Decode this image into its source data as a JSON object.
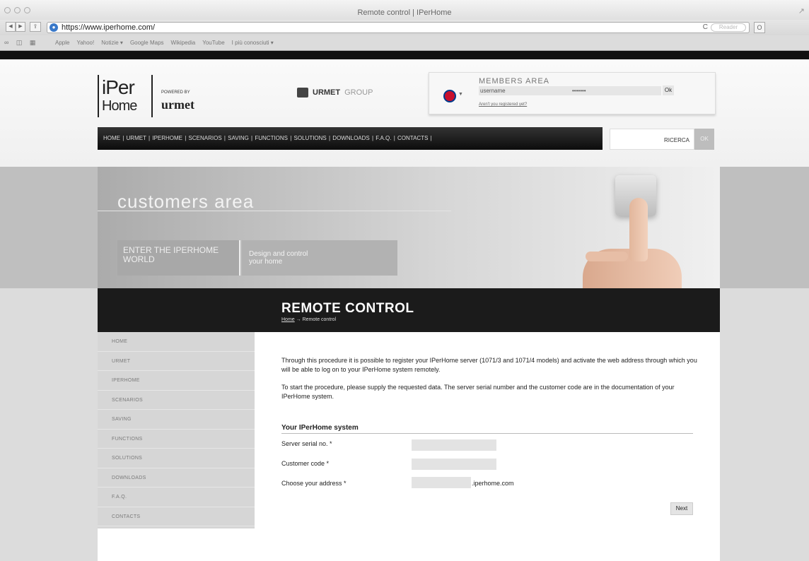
{
  "browser": {
    "window_title": "Remote control | IPerHome",
    "nav_back": "◀",
    "nav_forward": "▶",
    "share": "⇪",
    "url": "https://www.iperhome.com/",
    "reload": "C",
    "reader": "Reader",
    "right_button": "O",
    "bookmark_icons": "∞ ◫ ▦",
    "bookmarks": [
      "Apple",
      "Yahoo!",
      "Notizie ▾",
      "Google Maps",
      "Wikipedia",
      "YouTube",
      "I più conosciuti ▾"
    ]
  },
  "header": {
    "logo_line1": "iPer",
    "logo_line2": "Home",
    "powered_by": "POWERED BY",
    "urmet": "urmet",
    "group_logo_bold": "URMET",
    "group_logo_light": "GROUP",
    "members": {
      "title": "MEMBERS AREA",
      "username_value": "username",
      "password_value": "•••••••",
      "ok_label": "Ok",
      "register_link": "Aren't you registered yet?"
    },
    "nav_items": "HOME  |  URMET  |  IPERHOME  |  SCENARIOS  |  SAVING  |  FUNCTIONS  |  SOLUTIONS  |  DOWNLOADS  |  F.A.Q.  |  CONTACTS  |",
    "search_label": "RICERCA",
    "search_ok": "OK"
  },
  "hero": {
    "title": "customers area",
    "enter_world_line1": "ENTER THE IPERHOME",
    "enter_world_line2": "WORLD",
    "design_line1": "Design and control",
    "design_line2": "your home"
  },
  "page": {
    "title": "REMOTE CONTROL",
    "breadcrumb_home": "Home",
    "breadcrumb_sep": " → ",
    "breadcrumb_current": "Remote control",
    "side_menu": [
      "HOME",
      "URMET",
      "IPERHOME",
      "SCENARIOS",
      "SAVING",
      "FUNCTIONS",
      "SOLUTIONS",
      "DOWNLOADS",
      "F.A.Q.",
      "CONTACTS"
    ],
    "intro_p1": "Through this procedure it is possible to register your IPerHome server (1071/3 and 1071/4 models) and activate the web address through which you will be able to log on to your IPerHome system remotely.",
    "intro_p2": "To start the procedure, please supply the requested data. The server serial number and the customer code are in the documentation of your IPerHome system.",
    "system_title": "Your IPerHome system",
    "fields": {
      "serial_label": "Server serial no. *",
      "customer_label": "Customer code *",
      "address_label": "Choose your address *",
      "address_suffix": ".iperhome.com"
    },
    "next_label": "Next"
  },
  "colors": {
    "nav_bar": "#111111",
    "title_band": "#1b1b1b",
    "side_menu": "#d6d6d6",
    "input_fill": "#e3e3e3"
  }
}
